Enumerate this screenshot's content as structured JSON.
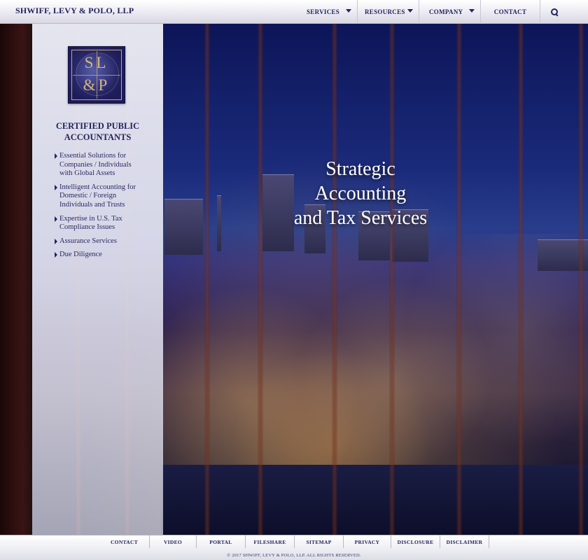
{
  "header": {
    "brand": "SHWIFF, LEVY & POLO, LLP",
    "nav": {
      "services": "SERVICES",
      "resources": "RESOURCES",
      "company": "COMPANY",
      "contact": "CONTACT"
    },
    "search_icon": "search-icon"
  },
  "sidebar": {
    "logo": {
      "row1": "SL",
      "row2": "&P"
    },
    "title_line1": "CERTIFIED PUBLIC",
    "title_line2": "ACCOUNTANTS",
    "items": [
      {
        "label": "Essential Solutions for Companies / Individuals with Global Assets"
      },
      {
        "label": "Intelligent Accounting for Domestic / Foreign Individuals and Trusts"
      },
      {
        "label": "Expertise in U.S. Tax Compliance Issues"
      },
      {
        "label": "Assurance Services"
      },
      {
        "label": "Due Diligence"
      }
    ]
  },
  "hero": {
    "line1": "Strategic",
    "line2": "Accounting",
    "line3": "and Tax Services"
  },
  "footer": {
    "links": [
      "CONTACT",
      "VIDEO",
      "PORTAL",
      "FILESHARE",
      "SITEMAP",
      "PRIVACY",
      "DISCLOSURE",
      "DISCLAIMER"
    ],
    "copyright": "© 2017 SHWIFF, LEVY & POLO, LLP. ALL RIGHTS RESERVED."
  },
  "colors": {
    "brand_navy": "#24235e",
    "logo_gold": "#d3b47c"
  }
}
